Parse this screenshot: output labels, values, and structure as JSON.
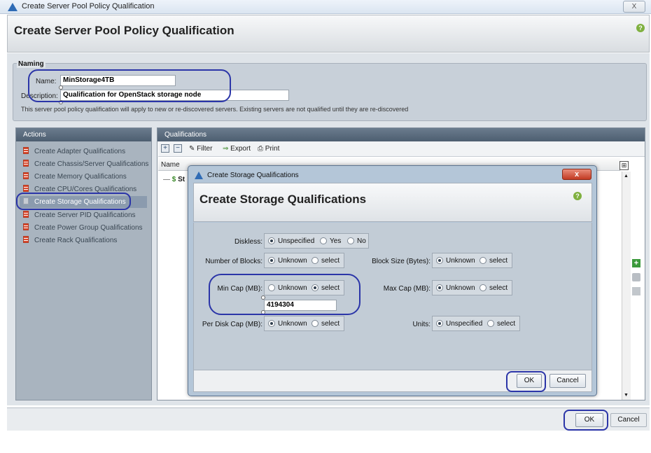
{
  "window": {
    "title": "Create Server Pool Policy Qualification",
    "close_label": "X"
  },
  "header": {
    "title": "Create Server Pool Policy Qualification",
    "help_icon": "?"
  },
  "naming": {
    "legend": "Naming",
    "name_label": "Name:",
    "name_value": "MinStorage4TB",
    "description_label": "Description:",
    "description_value": "Qualification for OpenStack storage node",
    "info": "This server pool policy qualification will apply to new or re-discovered servers. Existing servers are not qualified until they are re-discovered"
  },
  "actions": {
    "title": "Actions",
    "items": [
      {
        "label": "Create Adapter Qualifications"
      },
      {
        "label": "Create Chassis/Server Qualifications"
      },
      {
        "label": "Create Memory Qualifications"
      },
      {
        "label": "Create CPU/Cores Qualifications"
      },
      {
        "label": "Create Storage Qualifications"
      },
      {
        "label": "Create Server PID Qualifications"
      },
      {
        "label": "Create Power Group Qualifications"
      },
      {
        "label": "Create Rack Qualifications"
      }
    ],
    "selected_index": 4
  },
  "qualifications": {
    "title": "Qualifications",
    "toolbar": {
      "filter": "Filter",
      "export": "Export",
      "print": "Print"
    },
    "columns": [
      "Name"
    ],
    "row_partial": "St"
  },
  "dialog": {
    "window_title": "Create Storage Qualifications",
    "title": "Create Storage Qualifications",
    "close_label": "x",
    "diskless": {
      "label": "Diskless:",
      "options": [
        "Unspecified",
        "Yes",
        "No"
      ],
      "selected": "Unspecified"
    },
    "num_blocks": {
      "label": "Number of Blocks:",
      "options": [
        "Unknown",
        "select"
      ],
      "selected": "Unknown"
    },
    "block_size": {
      "label": "Block Size (Bytes):",
      "options": [
        "Unknown",
        "select"
      ],
      "selected": "Unknown"
    },
    "min_cap": {
      "label": "Min Cap (MB):",
      "options": [
        "Unknown",
        "select"
      ],
      "selected": "select",
      "value": "4194304"
    },
    "max_cap": {
      "label": "Max Cap (MB):",
      "options": [
        "Unknown",
        "select"
      ],
      "selected": "Unknown"
    },
    "per_disk_cap": {
      "label": "Per Disk Cap (MB):",
      "options": [
        "Unknown",
        "select"
      ],
      "selected": "Unknown"
    },
    "units": {
      "label": "Units:",
      "options": [
        "Unspecified",
        "select"
      ],
      "selected": "Unspecified"
    },
    "ok_label": "OK",
    "cancel_label": "Cancel"
  },
  "footer": {
    "ok_label": "OK",
    "cancel_label": "Cancel"
  },
  "colors": {
    "annotation": "#2b35a8",
    "panel_header": "#5a6b7d",
    "help": "#7fb03f"
  }
}
